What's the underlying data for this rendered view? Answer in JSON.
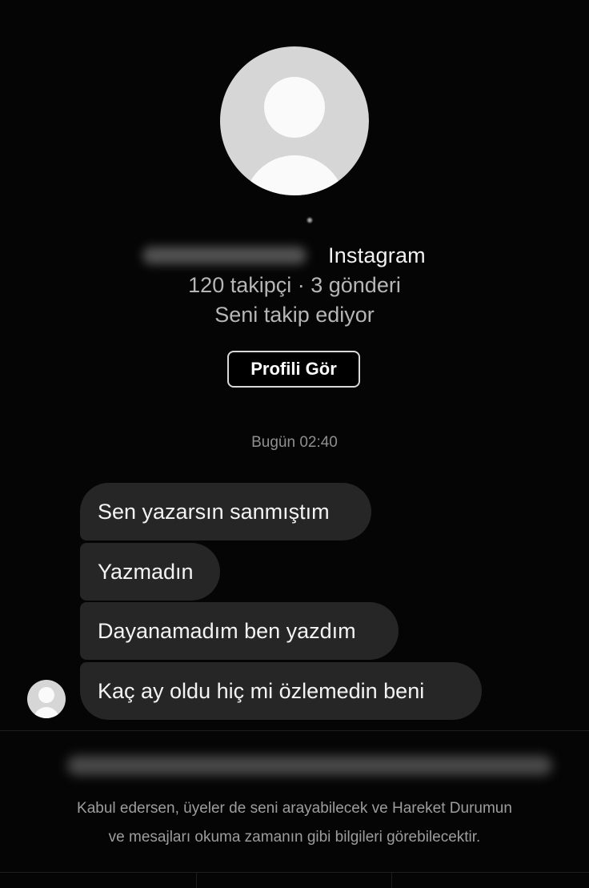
{
  "profile": {
    "platform": "Instagram",
    "stats": "120 takipçi · 3 gönderi",
    "follow_status": "Seni takip ediyor",
    "view_profile_label": "Profili Gör"
  },
  "conversation": {
    "timestamp": "Bugün 02:40",
    "messages": [
      "Sen yazarsın sanmıştım",
      "Yazmadın",
      "Dayanamadım ben yazdım",
      "Kaç ay oldu hiç mi özlemedin beni"
    ]
  },
  "request": {
    "info_line1": "Kabul edersen, üyeler de seni arayabilecek ve Hareket Durumun",
    "info_line2": "ve mesajları okuma zamanın gibi bilgileri görebilecektir."
  },
  "icons": {
    "profile_avatar": "default-user-avatar-icon",
    "sender_avatar": "default-user-avatar-icon"
  },
  "colors": {
    "background": "#050505",
    "bubble": "#262626",
    "secondary_text": "#b6b6b6",
    "muted_text": "#9d9d9d"
  }
}
